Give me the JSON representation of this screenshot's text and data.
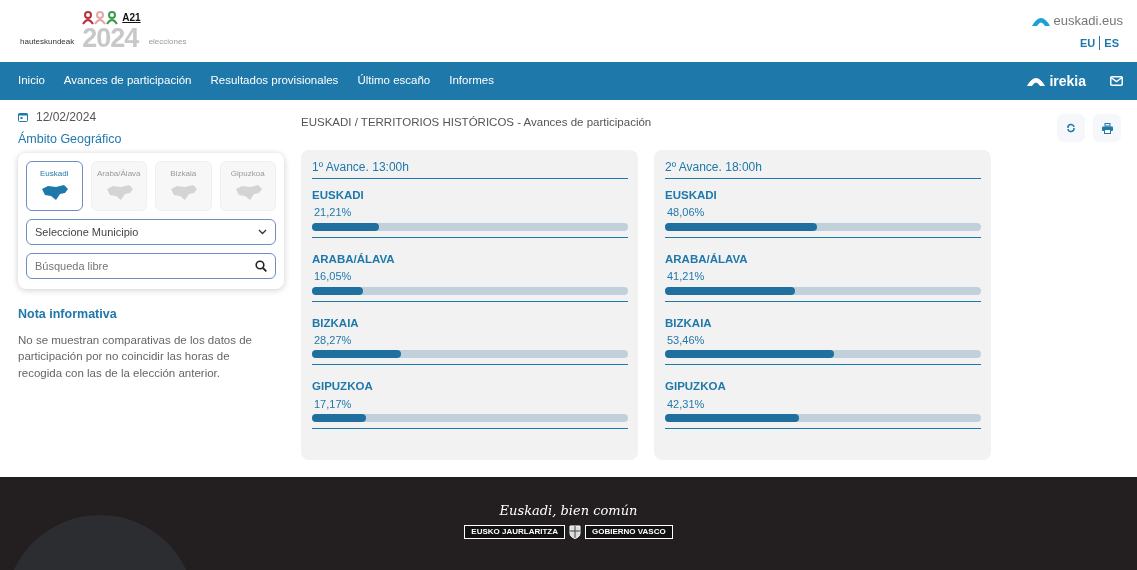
{
  "header": {
    "logo": {
      "brand": "hauteskundeak",
      "badge": "A21",
      "year": "2024",
      "subtitle": "elecciones"
    },
    "portal": {
      "name": "euskadi",
      "suffix": ".eus"
    },
    "languages": [
      {
        "label": "EU"
      },
      {
        "label": "ES"
      }
    ]
  },
  "nav": {
    "items": [
      {
        "label": "Inicio"
      },
      {
        "label": "Avances de participación"
      },
      {
        "label": "Resultados provisionales"
      },
      {
        "label": "Último escaño"
      },
      {
        "label": "Informes"
      }
    ],
    "brand": "irekia"
  },
  "sidebar": {
    "date": "12/02/2024",
    "scope_title": "Ámbito Geográfico",
    "regions": [
      {
        "label": "Euskadi",
        "selected": true
      },
      {
        "label": "Araba/Álava",
        "selected": false
      },
      {
        "label": "Bizkaia",
        "selected": false
      },
      {
        "label": "Gipuzkoa",
        "selected": false
      }
    ],
    "municipality_select": "Seleccione Municipio",
    "search": {
      "placeholder": "Búsqueda libre"
    },
    "note_title": "Nota informativa",
    "note_text": "No se muestran comparativas de los datos de participación por no coincidir las horas de recogida con las de la elección anterior."
  },
  "breadcrumb": "EUSKADI / TERRITORIOS HISTÓRICOS - Avances de participación",
  "advances": [
    {
      "title": "1º Avance. 13:00h",
      "rows": [
        {
          "name": "EUSKADI",
          "reading": "21,21%",
          "level": 0.2121
        },
        {
          "name": "ARABA/ÁLAVA",
          "reading": "16,05%",
          "level": 0.1605
        },
        {
          "name": "BIZKAIA",
          "reading": "28,27%",
          "level": 0.2827
        },
        {
          "name": "GIPUZKOA",
          "reading": "17,17%",
          "level": 0.1717
        }
      ]
    },
    {
      "title": "2º Avance. 18:00h",
      "rows": [
        {
          "name": "EUSKADI",
          "reading": "48,06%",
          "level": 0.4806
        },
        {
          "name": "ARABA/ÁLAVA",
          "reading": "41,21%",
          "level": 0.4121
        },
        {
          "name": "BIZKAIA",
          "reading": "53,46%",
          "level": 0.5346
        },
        {
          "name": "GIPUZKOA",
          "reading": "42,31%",
          "level": 0.4231
        }
      ]
    }
  ],
  "footer": {
    "slogan": "Euskadi, bien común",
    "seal_left": "EUSKO JAURLARITZA",
    "seal_right": "GOBIERNO VASCO"
  }
}
